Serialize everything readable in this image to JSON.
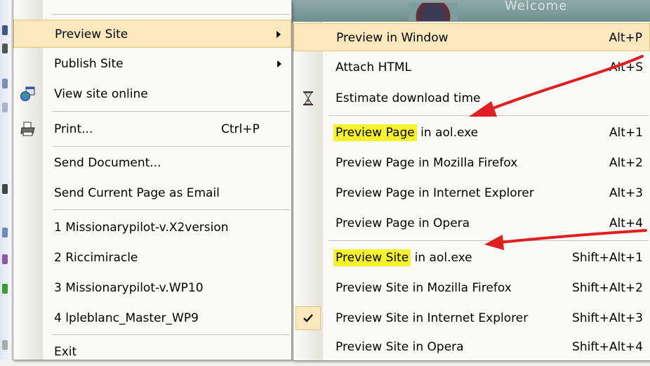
{
  "background": {
    "welcome_text": "Welcome"
  },
  "main_menu": {
    "preview_site": {
      "label": "Preview Site"
    },
    "publish_site": {
      "label": "Publish Site"
    },
    "view_online": {
      "label": "View site online"
    },
    "print": {
      "label": "Print...",
      "shortcut": "Ctrl+P"
    },
    "send_document": {
      "label": "Send Document..."
    },
    "send_page_email": {
      "label": "Send Current Page as Email"
    },
    "recent_1": {
      "label": "1 Missionarypilot-v.X2version"
    },
    "recent_2": {
      "label": "2 Riccimiracle"
    },
    "recent_3": {
      "label": "3 Missionarypilot-v.WP10"
    },
    "recent_4": {
      "label": "4 lpleblanc_Master_WP9"
    },
    "exit": {
      "label": "Exit"
    }
  },
  "sub_menu": {
    "preview_window": {
      "label": "Preview in Window",
      "shortcut": "Alt+P"
    },
    "attach_html": {
      "label": "Attach HTML",
      "shortcut": "Alt+S"
    },
    "estimate_download": {
      "label": "Estimate download time"
    },
    "page_aol": {
      "highlight": "Preview Page",
      "rest": " in aol.exe",
      "shortcut": "Alt+1"
    },
    "page_firefox": {
      "label": "Preview Page in Mozilla Firefox",
      "shortcut": "Alt+2"
    },
    "page_ie": {
      "label": "Preview Page in Internet Explorer",
      "shortcut": "Alt+3"
    },
    "page_opera": {
      "label": "Preview Page in Opera",
      "shortcut": "Alt+4"
    },
    "site_aol": {
      "highlight": "Preview Site",
      "rest": " in aol.exe",
      "shortcut": "Shift+Alt+1"
    },
    "site_firefox": {
      "label": "Preview Site in Mozilla Firefox",
      "shortcut": "Shift+Alt+2"
    },
    "site_ie": {
      "label": "Preview Site in Internet Explorer",
      "shortcut": "Shift+Alt+3",
      "checked": true
    },
    "site_opera": {
      "label": "Preview Site in Opera",
      "shortcut": "Shift+Alt+4"
    }
  },
  "colors": {
    "menu_highlight": "#fbe9bd",
    "text_highlight": "#f7f32b",
    "annotation_arrow": "#e02020"
  },
  "icons": [
    "globe-icon",
    "printer-icon",
    "hourglass-icon",
    "checkmark-icon",
    "submenu-arrow-icon"
  ]
}
